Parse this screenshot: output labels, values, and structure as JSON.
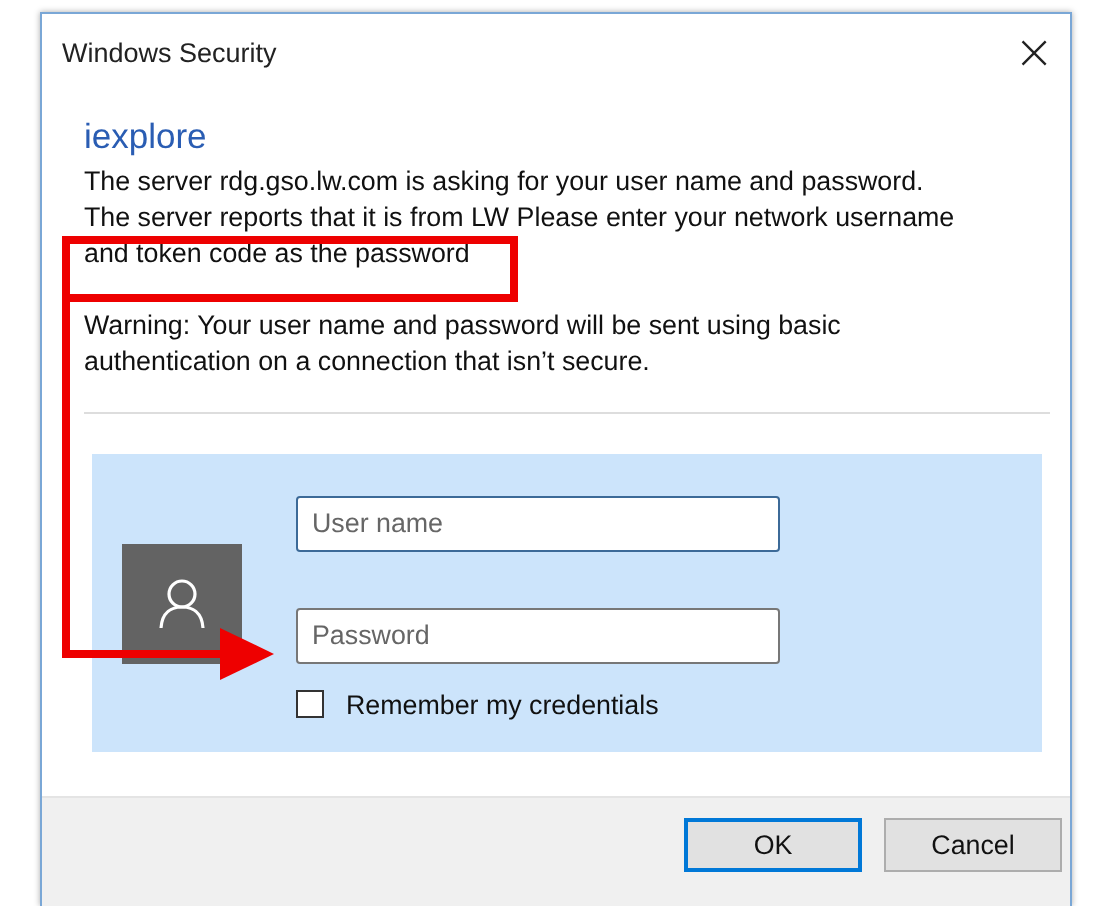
{
  "window": {
    "title": "Windows Security",
    "close": "×"
  },
  "app_name": "iexplore",
  "message_lines": [
    "The server rdg.gso.lw.com is asking for your user name and password.",
    "The server reports that it is from LW Please enter your network username",
    "and token code as the password"
  ],
  "warning_lines": [
    "Warning: Your user name and password will be sent using basic",
    "authentication on a connection that isn’t secure."
  ],
  "fields": [
    {
      "placeholder": "User name"
    },
    {
      "placeholder": "Password"
    }
  ],
  "remember": {
    "label": "Remember my credentials",
    "checked": false
  },
  "buttons": [
    {
      "label": "OK",
      "default": true
    },
    {
      "label": "Cancel",
      "default": false
    }
  ],
  "annotations": {
    "highlight_box": true,
    "arrow": true
  }
}
